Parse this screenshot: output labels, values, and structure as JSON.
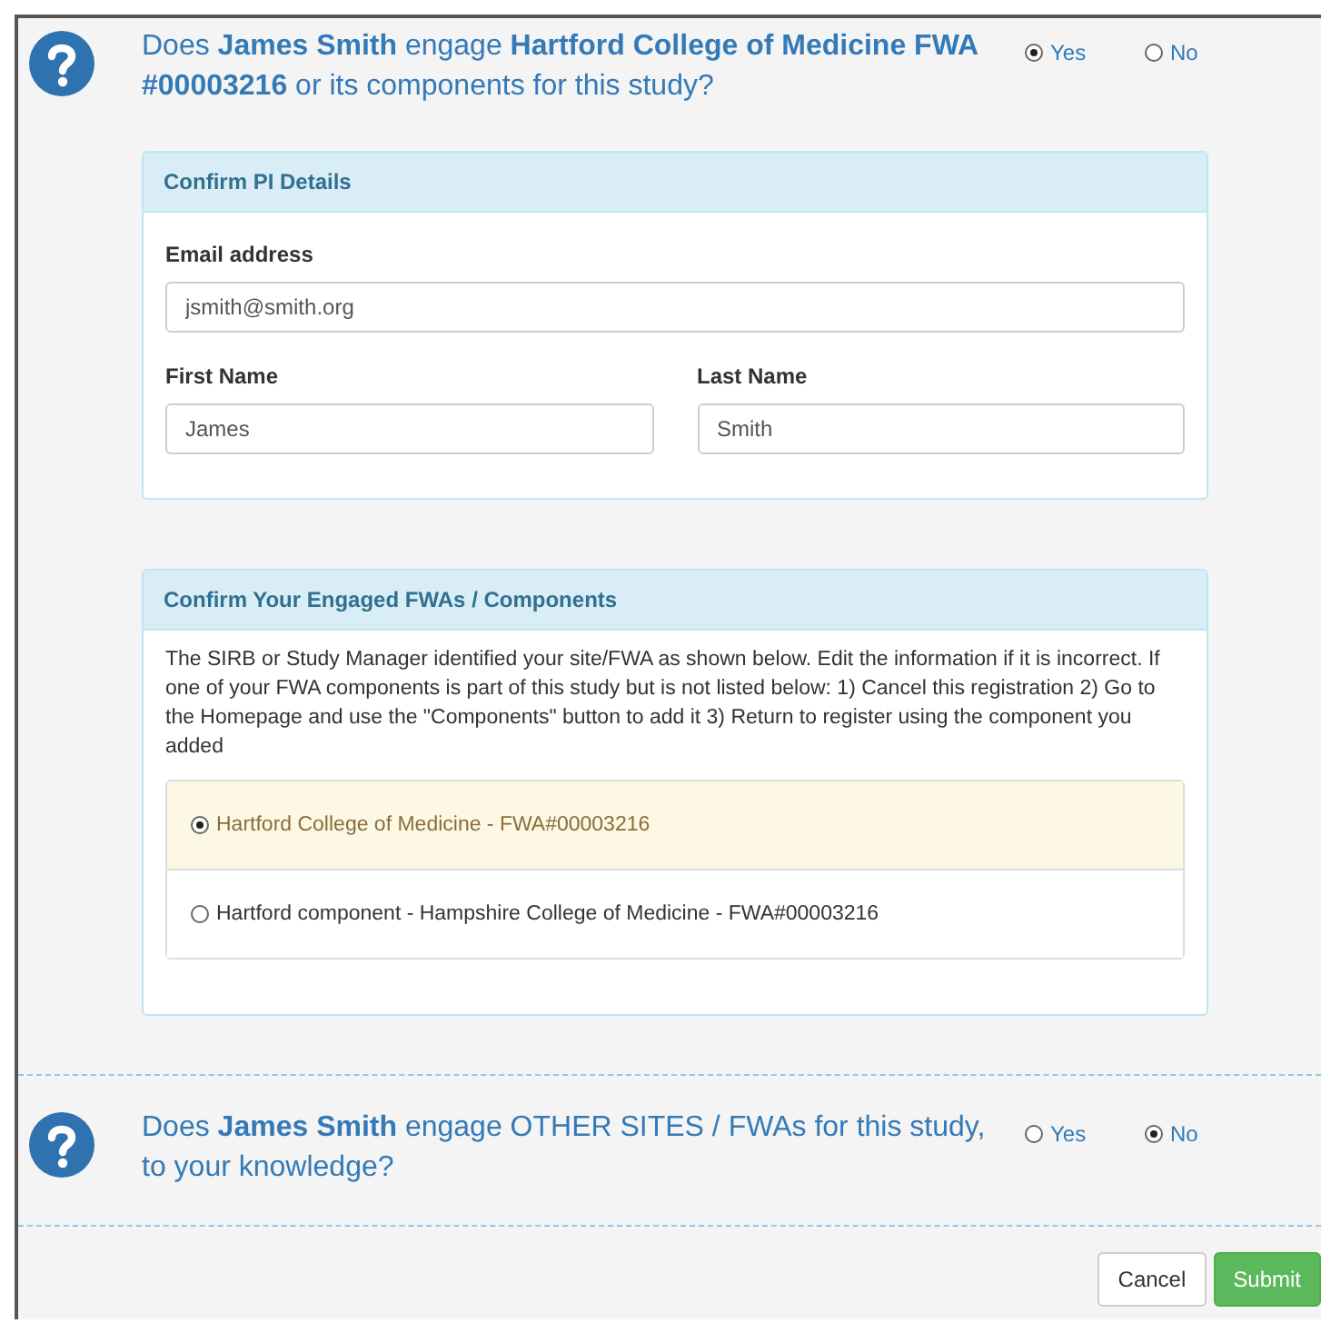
{
  "question_1": {
    "text": "Does **James Smith** engage **Hartford College of Medicine FWA #00003216** or its components for this study?",
    "options": [
      {
        "label": "Yes",
        "selected": true
      },
      {
        "label": "No",
        "selected": false
      }
    ]
  },
  "pi_panel": {
    "title": "Confirm PI Details",
    "email": {
      "label": "Email address",
      "value": "jsmith@smith.org"
    },
    "first_name": {
      "label": "First Name",
      "value": "James"
    },
    "last_name": {
      "label": "Last Name",
      "value": "Smith"
    }
  },
  "fwa_panel": {
    "title": "Confirm Your Engaged FWAs / Components",
    "description": "The SIRB or Study Manager identified your site/FWA as shown below. Edit the information if it is incorrect. If one of your FWA components is part of this study but is not listed below: 1) Cancel this registration 2) Go to the Homepage and use the \"Components\" button to add it 3) Return to register using the component you added",
    "options": [
      {
        "label": "Hartford College of Medicine - FWA#00003216",
        "selected": true
      },
      {
        "label": "Hartford component - Hampshire College of Medicine - FWA#00003216",
        "selected": false
      }
    ]
  },
  "question_2": {
    "text": "Does **James Smith** engage OTHER SITES / FWAs for this study, to your knowledge?",
    "options": [
      {
        "label": "Yes",
        "selected": false
      },
      {
        "label": "No",
        "selected": true
      }
    ]
  },
  "buttons": [
    {
      "label": "Cancel",
      "kind": "default"
    },
    {
      "label": "Submit",
      "kind": "primary"
    }
  ]
}
